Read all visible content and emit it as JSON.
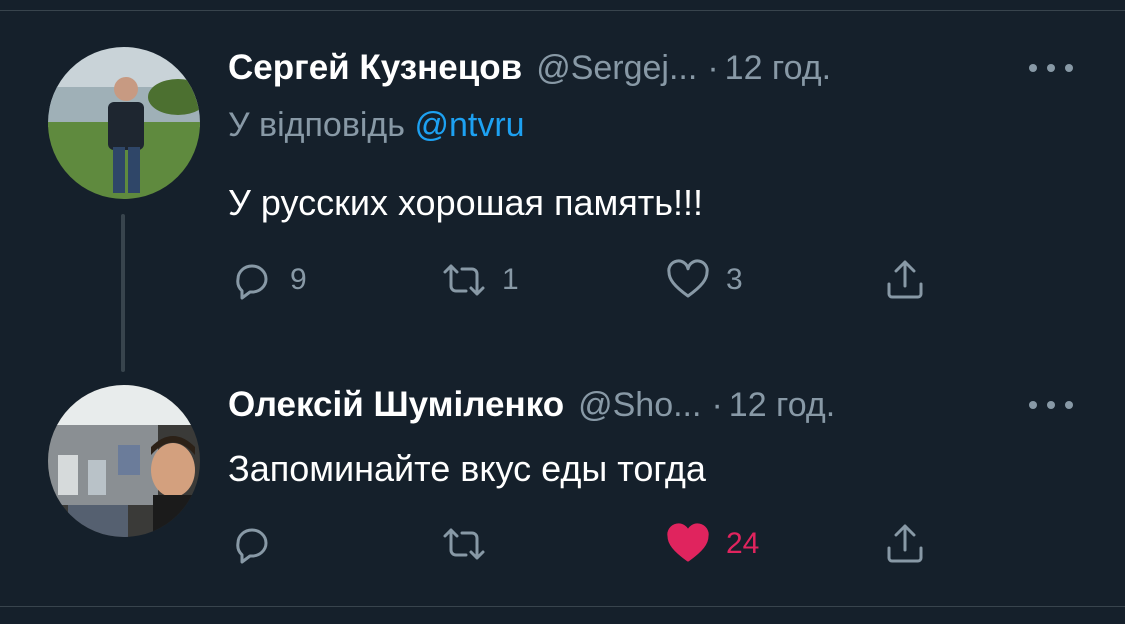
{
  "tweets": [
    {
      "name": "Сергей Кузнецов",
      "handle": "@Sergej...",
      "separator": "·",
      "time": "12 год.",
      "reply_prefix": "У відповідь",
      "reply_mention": "@ntvru",
      "text": "У русских хорошая память!!!",
      "counts": {
        "reply": "9",
        "retweet": "1",
        "like": "3"
      },
      "liked": false
    },
    {
      "name": "Олексій Шуміленко",
      "handle": "@Sho...",
      "separator": "·",
      "time": "12 год.",
      "text": "Запоминайте вкус еды тогда",
      "counts": {
        "reply": "",
        "retweet": "",
        "like": "24"
      },
      "liked": true
    }
  ],
  "colors": {
    "background": "#15202b",
    "secondary_text": "#8899a6",
    "link": "#1da1f2",
    "like_active": "#e0245e",
    "divider": "#38444d"
  },
  "icons": [
    "reply-icon",
    "retweet-icon",
    "like-icon",
    "share-icon",
    "more-icon"
  ]
}
